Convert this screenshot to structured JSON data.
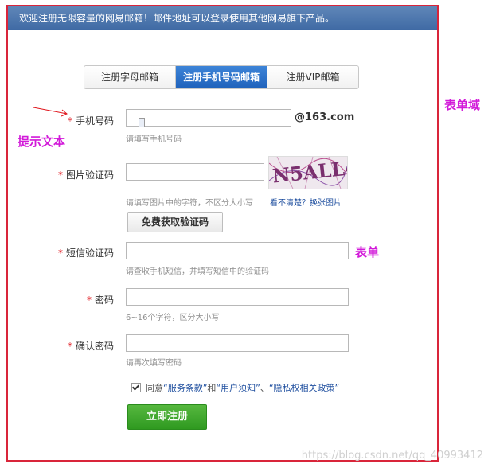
{
  "banner": {
    "text": "欢迎注册无限容量的网易邮箱！邮件地址可以登录使用其他网易旗下产品。"
  },
  "tabs": [
    {
      "label": "注册字母邮箱",
      "active": false
    },
    {
      "label": "注册手机号码邮箱",
      "active": true
    },
    {
      "label": "注册VIP邮箱",
      "active": false
    }
  ],
  "form": {
    "phone": {
      "label": "手机号码",
      "suffix": "@163.com",
      "hint": "请填写手机号码",
      "value": ""
    },
    "captcha": {
      "label": "图片验证码",
      "hint": "请填写图片中的字符，不区分大小写",
      "refresh_link": "看不清楚？换张图片",
      "image_text": "N5ALL4",
      "value": ""
    },
    "sms_button": "免费获取验证码",
    "sms": {
      "label": "短信验证码",
      "hint": "请查收手机短信，并填写短信中的验证码",
      "value": ""
    },
    "password": {
      "label": "密码",
      "hint": "6~16个字符，区分大小写",
      "value": ""
    },
    "confirm": {
      "label": "确认密码",
      "hint": "请再次填写密码",
      "value": ""
    },
    "agree": {
      "prefix": "同意",
      "terms": "“服务条款”",
      "and": "和",
      "notice": "“用户须知”",
      "sep": "、",
      "privacy": "“隐私权相关政策”",
      "checked": true
    },
    "submit": "立即注册"
  },
  "annotations": {
    "form_domain": "表单域",
    "hint_text": "提示文本",
    "form": "表单"
  },
  "watermark": "https://blog.csdn.net/qq_40993412",
  "colors": {
    "accent_blue": "#1f62bb",
    "required_star": "#e0181f",
    "annotation": "#d21ad9",
    "submit_green": "#2f9a20"
  }
}
